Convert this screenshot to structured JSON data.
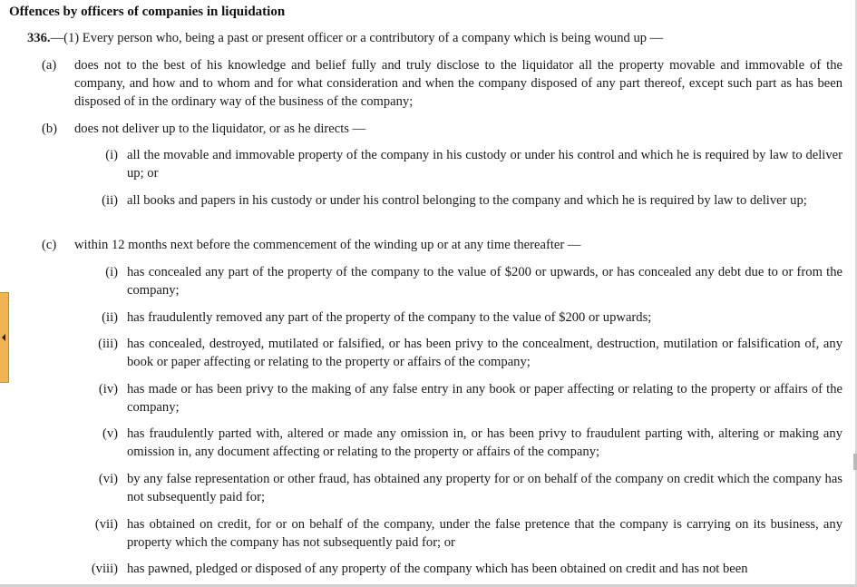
{
  "heading": "Offences by officers of companies in liquidation",
  "section": {
    "number": "336.",
    "intro": "—(1) Every person who, being a past or present officer or a contributory of a company which is being wound up —"
  },
  "paragraphs": [
    {
      "label": "(a)",
      "text": "does not to the best of his knowledge and belief fully and truly disclose to the liquidator all the property movable and immovable of the company, and how and to whom and for what consideration and when the company disposed of any part thereof, except such part as has been disposed of in the ordinary way of the business of the company;"
    },
    {
      "label": "(b)",
      "text": "does not deliver up to the liquidator, or as he directs —"
    },
    {
      "label": "(c)",
      "text": "within 12 months next before the commencement of the winding up or at any time thereafter —"
    }
  ],
  "b_items": [
    {
      "label": "(i)",
      "text": "all the movable and immovable property of the company in his custody or under his control and which he is required by law to deliver up; or"
    },
    {
      "label": "(ii)",
      "text": "all books and papers in his custody or under his control belonging to the company and which he is required by law to deliver up;"
    }
  ],
  "c_items": [
    {
      "label": "(i)",
      "text": "has concealed any part of the property of the company to the value of $200 or upwards, or has concealed any debt due to or from the company;"
    },
    {
      "label": "(ii)",
      "text": "has fraudulently removed any part of the property of the company to the value of $200 or upwards;"
    },
    {
      "label": "(iii)",
      "text": "has concealed, destroyed, mutilated or falsified, or has been privy to the concealment, destruction, mutilation or falsification of, any book or paper affecting or relating to the property or affairs of the company;"
    },
    {
      "label": "(iv)",
      "text": "has made or has been privy to the making of any false entry in any book or paper affecting or relating to the property or affairs of the company;"
    },
    {
      "label": "(v)",
      "text": "has fraudulently parted with, altered or made any omission in, or has been privy to fraudulent parting with, altering or making any omission in, any document affecting or relating to the property or affairs of the company;"
    },
    {
      "label": "(vi)",
      "text": "by any false representation or other fraud, has obtained any property for or on behalf of the company on credit which the company has not subsequently paid for;"
    },
    {
      "label": "(vii)",
      "text": "has obtained on credit, for or on behalf of the company, under the false pretence that the company is carrying on its business, any property which the company has not subsequently paid for; or"
    },
    {
      "label": "(viii)",
      "text": "has pawned, pledged or disposed of any property of the company which has been obtained on credit and has not been"
    }
  ],
  "ui": {
    "collapse_tab_icon": "chevron-left-icon"
  }
}
